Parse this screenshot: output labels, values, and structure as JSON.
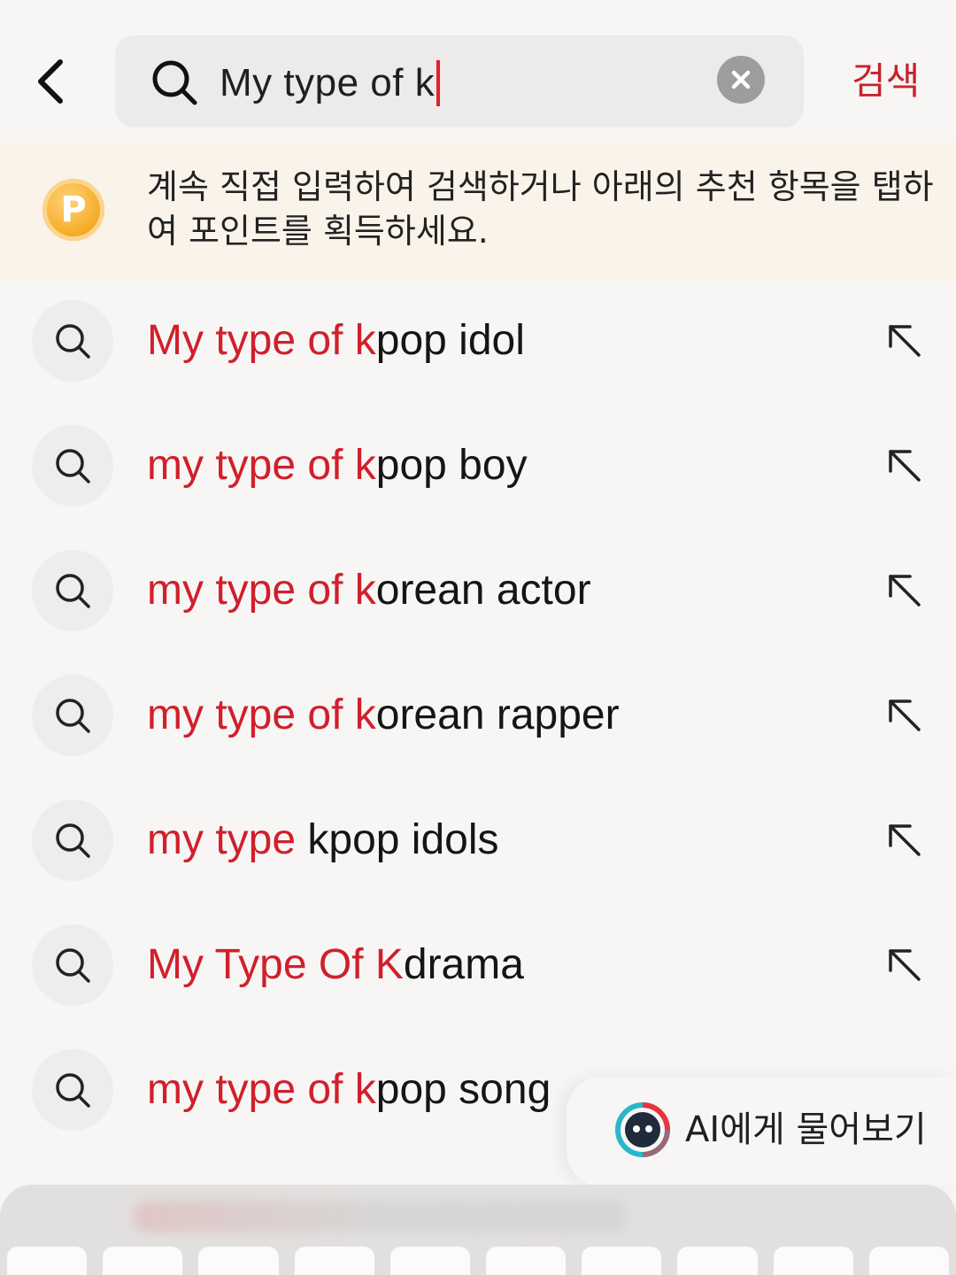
{
  "header": {
    "search_value": "My type of k",
    "search_action_label": "검색"
  },
  "banner": {
    "coin_letter": "P",
    "message": "계속 직접 입력하여 검색하거나 아래의 추천 항목을 탭하여 포인트를 획득하세요."
  },
  "suggestions": [
    {
      "match": "My type of k",
      "rest": "pop idol"
    },
    {
      "match": "my type of k",
      "rest": "pop boy"
    },
    {
      "match": "my type of k",
      "rest": "orean actor"
    },
    {
      "match": "my type of k",
      "rest": "orean rapper"
    },
    {
      "match": "my type",
      "rest": " kpop idols"
    },
    {
      "match": "My Type Of K",
      "rest": "drama"
    },
    {
      "match": "my type of k",
      "rest": "pop song"
    }
  ],
  "ai_button": {
    "label": "AI에게 물어보기"
  },
  "colors": {
    "accent": "#d11f2c",
    "background": "#f7f6f5",
    "banner_bg": "#faf3ea",
    "coin": "#f6ad2a"
  },
  "icons": {
    "back": "chevron-left-icon",
    "search": "search-icon",
    "clear": "clear-icon",
    "fill": "arrow-up-left-icon",
    "ai": "ai-chat-icon"
  }
}
